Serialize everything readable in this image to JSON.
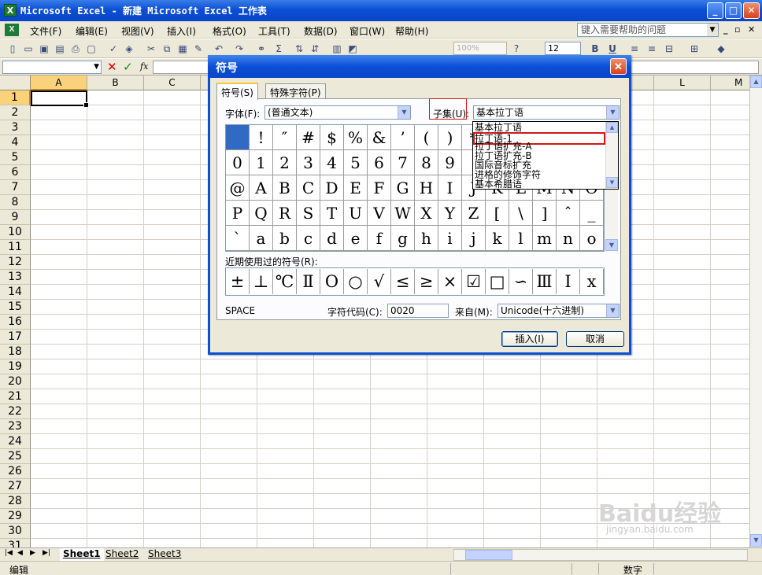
{
  "window": {
    "title": "Microsoft Excel - 新建 Microsoft Excel 工作表",
    "app_icon": "excel-icon",
    "controls": [
      "minimize",
      "restore",
      "close"
    ]
  },
  "menu": {
    "items": [
      "文件(F)",
      "编辑(E)",
      "视图(V)",
      "插入(I)",
      "格式(O)",
      "工具(T)",
      "数据(D)",
      "窗口(W)",
      "帮助(H)"
    ],
    "help_placeholder": "键入需要帮助的问题"
  },
  "toolbar": {
    "zoom": "100%",
    "font_size": "12",
    "bold": "B",
    "underline": "U"
  },
  "formula_bar": {
    "fx": "fx"
  },
  "sheet": {
    "columns": [
      "A",
      "B",
      "C",
      "L",
      "M"
    ],
    "rows": [
      "1",
      "2",
      "3",
      "4",
      "5",
      "6",
      "7",
      "8",
      "9",
      "10",
      "11",
      "12",
      "13",
      "14",
      "15",
      "16",
      "17",
      "18",
      "19",
      "20",
      "21",
      "22",
      "23",
      "24",
      "25",
      "26",
      "27",
      "28",
      "29",
      "30",
      "31"
    ],
    "active_cell": "A1",
    "tabs": [
      "Sheet1",
      "Sheet2",
      "Sheet3"
    ],
    "active_tab": "Sheet1"
  },
  "status": {
    "mode": "编辑",
    "numlock": "数字"
  },
  "dialog": {
    "title": "符号",
    "tabs": [
      "符号(S)",
      "特殊字符(P)"
    ],
    "font_label": "字体(F):",
    "font_value": "(普通文本)",
    "subset_label": "子集(U):",
    "subset_value": "基本拉丁语",
    "subset_options": [
      "基本拉丁语",
      "拉丁语-1",
      "拉丁语扩充-A",
      "拉丁语扩充-B",
      "国际音标扩充",
      "进格的修饰字符",
      "基本希腊语"
    ],
    "subset_highlighted": "拉丁语-1",
    "symbols": [
      " ",
      "!",
      "″",
      "#",
      "$",
      "%",
      "&",
      "’",
      "(",
      ")",
      "*",
      "+",
      ",",
      "-",
      ".",
      "/",
      "0",
      "1",
      "2",
      "3",
      "4",
      "5",
      "6",
      "7",
      "8",
      "9",
      ":",
      ";",
      "<",
      "=",
      ">",
      "?",
      "@",
      "A",
      "B",
      "C",
      "D",
      "E",
      "F",
      "G",
      "H",
      "I",
      "J",
      "K",
      "L",
      "M",
      "N",
      "O",
      "P",
      "Q",
      "R",
      "S",
      "T",
      "U",
      "V",
      "W",
      "X",
      "Y",
      "Z",
      "[",
      "\\",
      "]",
      "ˆ",
      "_",
      "`",
      "a",
      "b",
      "c",
      "d",
      "e",
      "f",
      "g",
      "h",
      "i",
      "j",
      "k",
      "l",
      "m",
      "n",
      "o"
    ],
    "recent_label": "近期使用过的符号(R):",
    "recent_symbols": [
      "±",
      "⊥",
      "℃",
      "Ⅱ",
      "O",
      "○",
      "√",
      "≤",
      "≥",
      "×",
      "☑",
      "□",
      "∽",
      "Ⅲ",
      "Ⅰ",
      "x"
    ],
    "char_name": "SPACE",
    "char_code_label": "字符代码(C):",
    "char_code": "0020",
    "from_label": "来自(M):",
    "from_value": "Unicode(十六进制)",
    "insert_button": "插入(I)",
    "cancel_button": "取消"
  },
  "watermark": {
    "brand": "Baidu经验",
    "url": "jingyan.baidu.com"
  },
  "colors": {
    "titlebar": "#0b4fd6",
    "selection": "#316ac5",
    "highlight_border": "#d01818"
  }
}
